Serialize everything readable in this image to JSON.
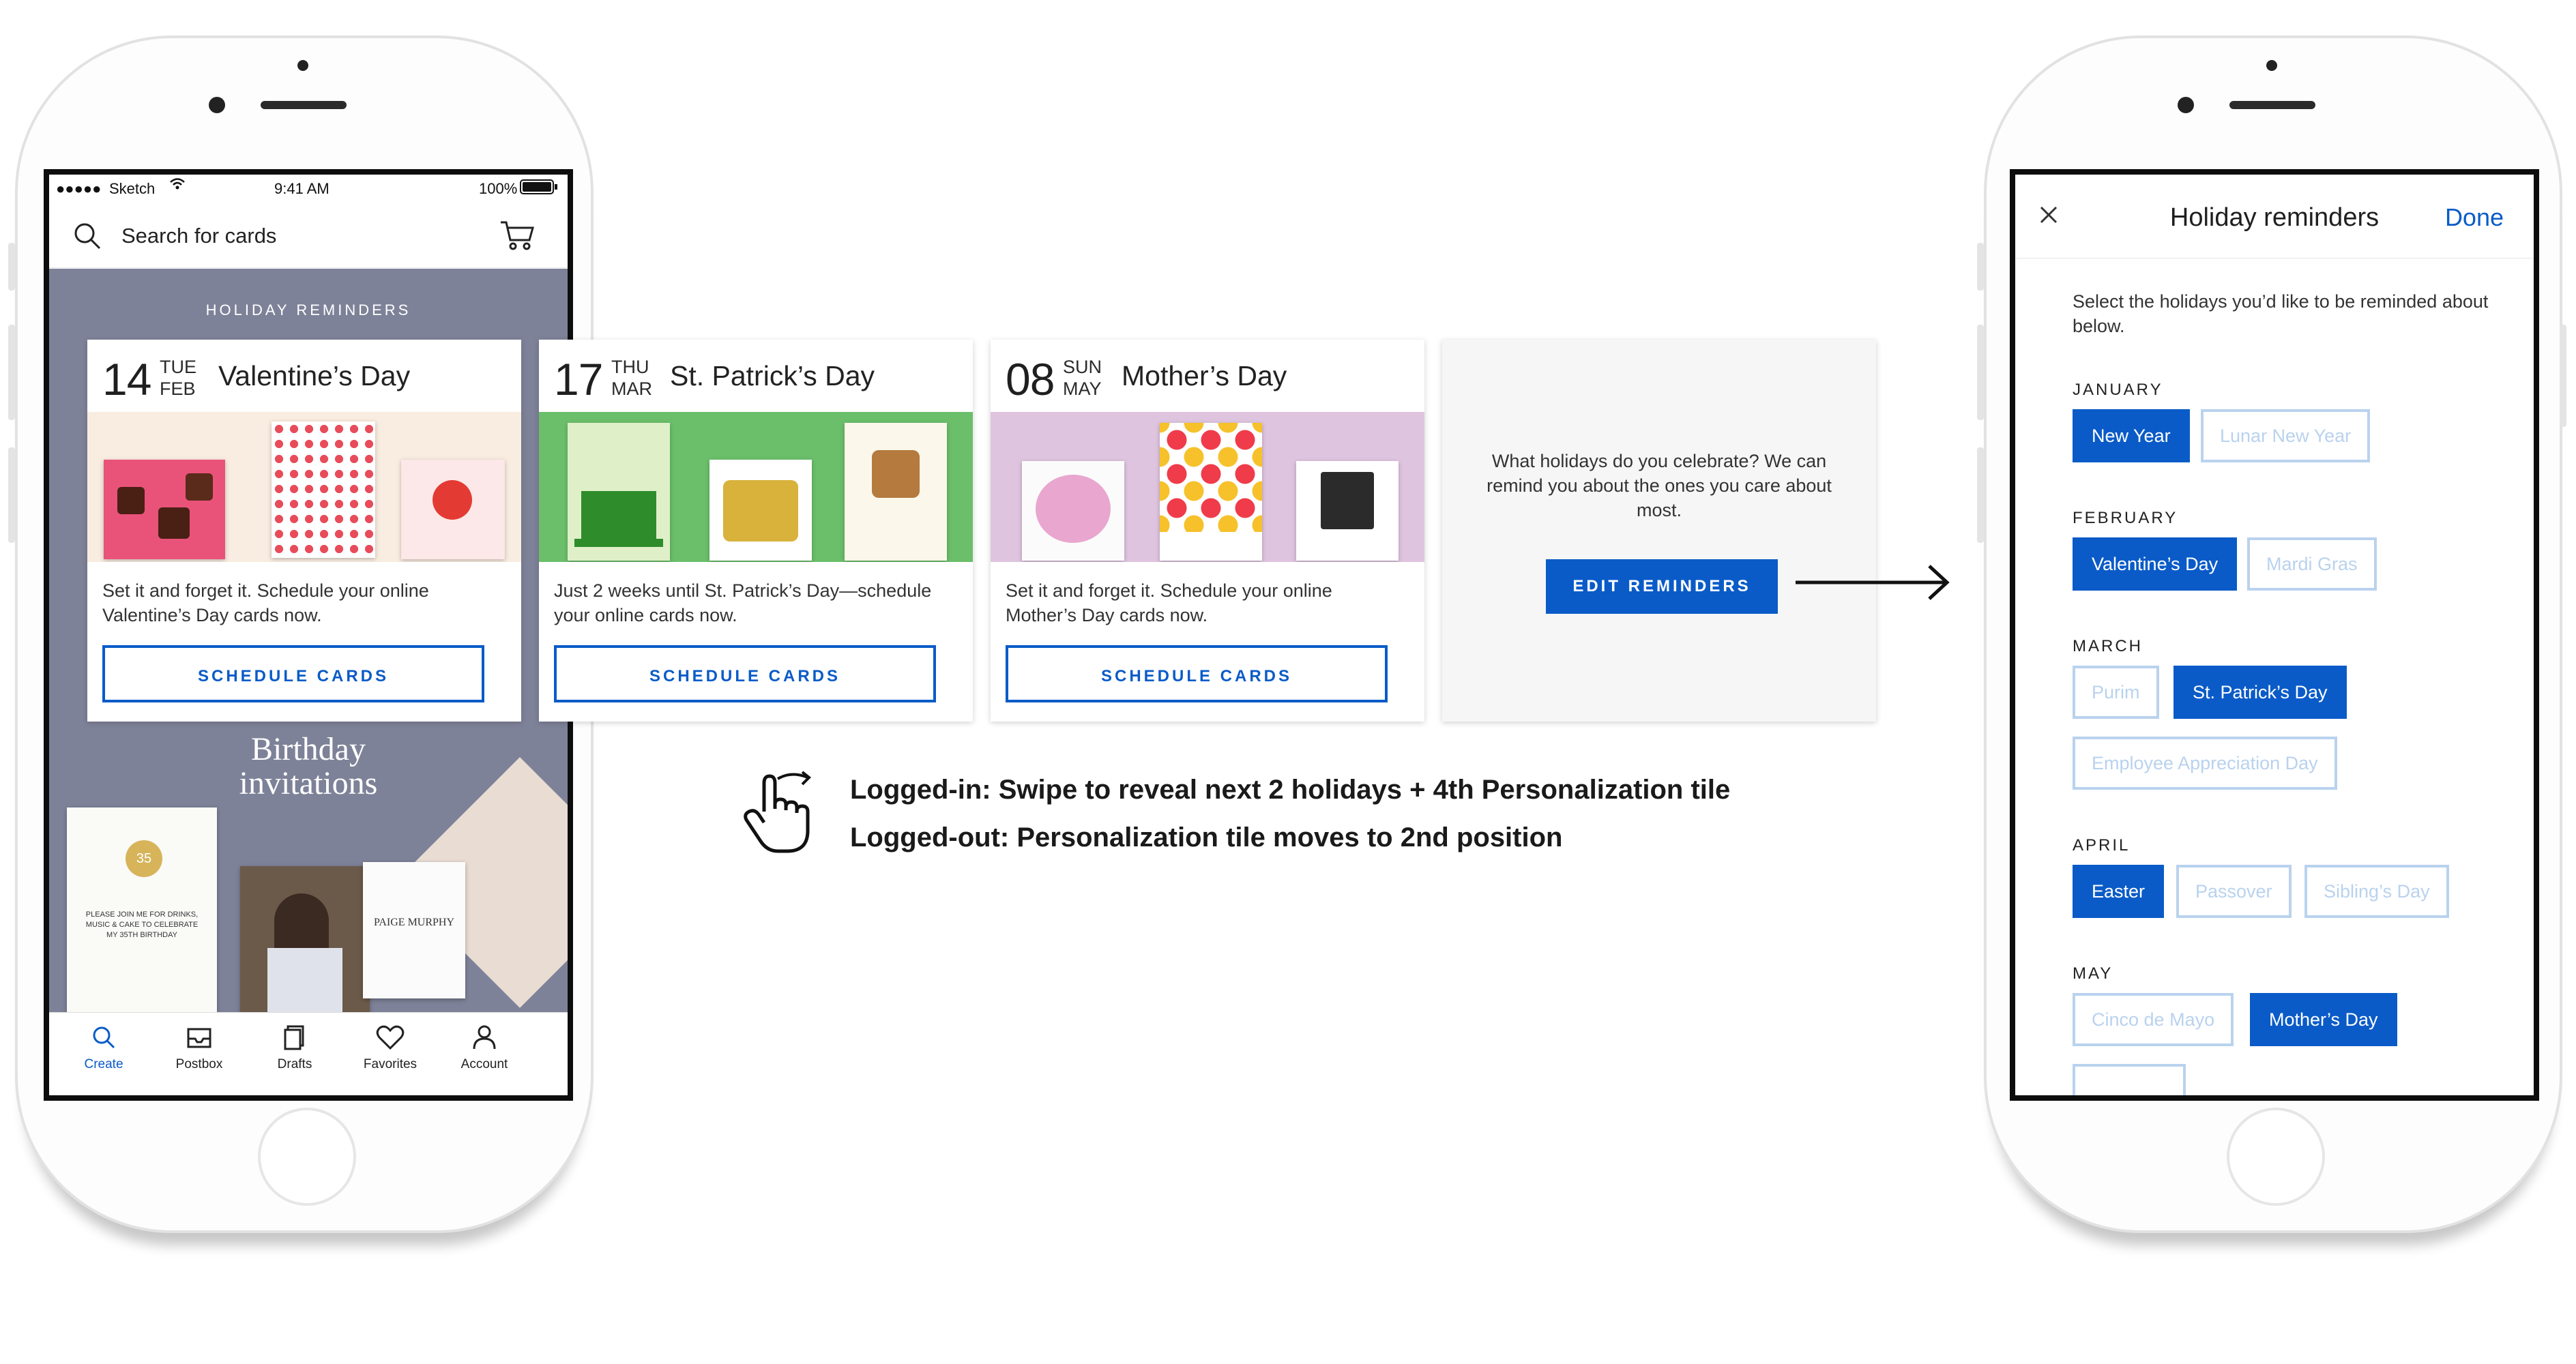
{
  "status_bar": {
    "carrier": "Sketch",
    "time": "9:41 AM",
    "battery": "100%"
  },
  "search": {
    "placeholder": "Search for cards"
  },
  "holiday_section": {
    "title": "HOLIDAY REMINDERS"
  },
  "holiday_cards": [
    {
      "day": "14",
      "weekday": "TUE",
      "month": "FEB",
      "name": "Valentine’s Day",
      "description": "Set it and forget it. Schedule your online Valentine’s Day cards now.",
      "button": "SCHEDULE CARDS"
    },
    {
      "day": "17",
      "weekday": "THU",
      "month": "MAR",
      "name": "St. Patrick’s Day",
      "description": "Just 2 weeks until St. Patrick’s Day—schedule your online cards now.",
      "button": "SCHEDULE CARDS"
    },
    {
      "day": "08",
      "weekday": "SUN",
      "month": "MAY",
      "name": "Mother’s Day",
      "description": "Set it and forget it. Schedule your online Mother’s Day cards now.",
      "button": "SCHEDULE CARDS"
    }
  ],
  "personalization_tile": {
    "message": "What holidays do you celebrate? We can remind you about the ones you care about most.",
    "button": "EDIT REMINDERS"
  },
  "birthday_promo": {
    "title_line1": "Birthday",
    "title_line2": "invitations",
    "card1_text": "PLEASE JOIN ME FOR DRINKS, MUSIC & CAKE TO CELEBRATE MY 35TH BIRTHDAY",
    "card1_badge": "35",
    "card2_name": "PAIGE MURPHY"
  },
  "tab_bar": [
    {
      "label": "Create",
      "icon": "search-icon",
      "active": true
    },
    {
      "label": "Postbox",
      "icon": "inbox-icon",
      "active": false
    },
    {
      "label": "Drafts",
      "icon": "drafts-icon",
      "active": false
    },
    {
      "label": "Favorites",
      "icon": "heart-icon",
      "active": false
    },
    {
      "label": "Account",
      "icon": "person-icon",
      "active": false
    }
  ],
  "annotations": {
    "line1": "Logged-in: Swipe to reveal next 2 holidays + 4th Personalization tile",
    "line2": "Logged-out: Personalization tile moves to 2nd position"
  },
  "modal": {
    "title": "Holiday reminders",
    "done": "Done",
    "intro": "Select the holidays you’d like to be reminded about below.",
    "months": [
      {
        "name": "JANUARY",
        "holidays": [
          {
            "label": "New Year",
            "selected": true
          },
          {
            "label": "Lunar New Year",
            "selected": false
          }
        ]
      },
      {
        "name": "FEBRUARY",
        "holidays": [
          {
            "label": "Valentine’s Day",
            "selected": true
          },
          {
            "label": "Mardi Gras",
            "selected": false
          }
        ]
      },
      {
        "name": "MARCH",
        "holidays": [
          {
            "label": "Purim",
            "selected": false
          },
          {
            "label": "St. Patrick’s Day",
            "selected": true
          },
          {
            "label": "Employee Appreciation Day",
            "selected": false
          }
        ]
      },
      {
        "name": "APRIL",
        "holidays": [
          {
            "label": "Easter",
            "selected": true
          },
          {
            "label": "Passover",
            "selected": false
          },
          {
            "label": "Sibling’s Day",
            "selected": false
          }
        ]
      },
      {
        "name": "MAY",
        "holidays": [
          {
            "label": "Cinco de Mayo",
            "selected": false
          },
          {
            "label": "Mother’s Day",
            "selected": true
          }
        ]
      }
    ]
  },
  "colors": {
    "accent": "#0a5bc8",
    "feed_background": "#7e8298",
    "chip_off": "#b9d2ee"
  }
}
